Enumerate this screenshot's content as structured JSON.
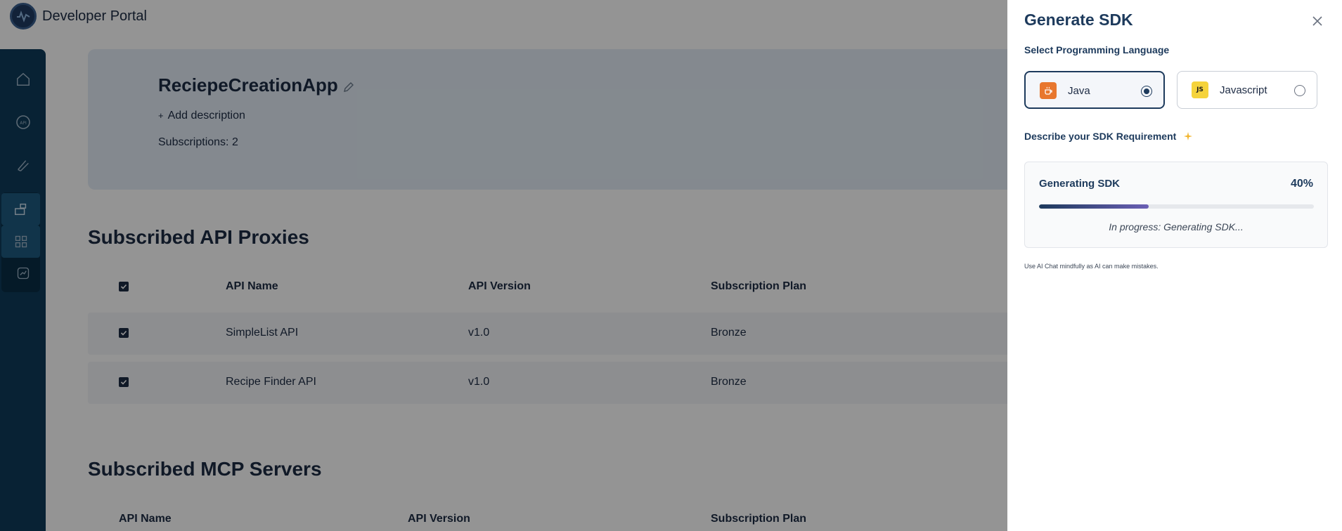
{
  "header": {
    "brand": "Developer Portal"
  },
  "app": {
    "name": "ReciepeCreationApp",
    "add_description": "Add description",
    "subscriptions": "Subscriptions: 2"
  },
  "api_proxies": {
    "title": "Subscribed API Proxies",
    "columns": [
      "API Name",
      "API Version",
      "Subscription Plan"
    ],
    "rows": [
      {
        "name": "SimpleList API",
        "version": "v1.0",
        "plan": "Bronze"
      },
      {
        "name": "Recipe Finder API",
        "version": "v1.0",
        "plan": "Bronze"
      }
    ]
  },
  "mcp_servers": {
    "title": "Subscribed MCP Servers",
    "columns": [
      "API Name",
      "API Version",
      "Subscription Plan"
    ]
  },
  "drawer": {
    "title": "Generate SDK",
    "language_label": "Select Programming Language",
    "languages": [
      {
        "name": "Java",
        "selected": true,
        "icon": "java-icon",
        "color": "#e8772e"
      },
      {
        "name": "Javascript",
        "selected": false,
        "icon": "js-icon",
        "badge": "JS",
        "color": "#f5d33b"
      }
    ],
    "requirement_label": "Describe your SDK Requirement",
    "progress": {
      "label": "Generating SDK",
      "percent_text": "40%",
      "value": 0.4,
      "message": "In progress: Generating SDK..."
    },
    "disclaimer": "Use AI Chat mindfully as AI can make mistakes."
  },
  "colors": {
    "primary": "#1d3a5c",
    "sidebar": "#0f3c5a",
    "accent_gradient_end": "#6b5fb5"
  }
}
